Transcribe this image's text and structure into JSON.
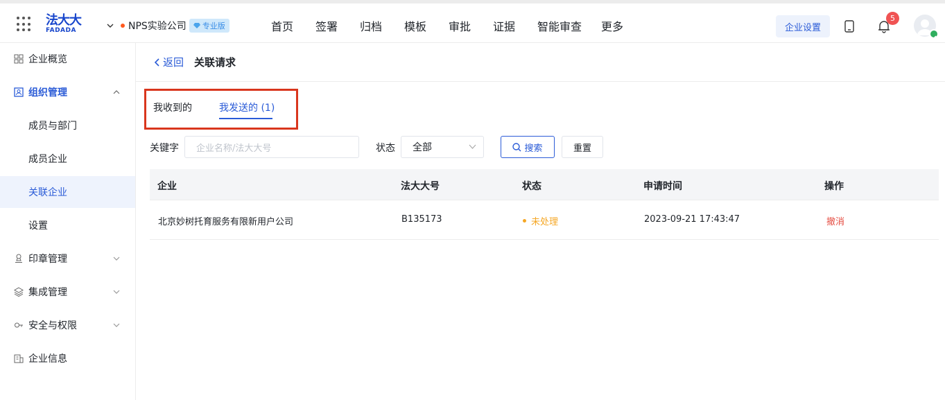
{
  "header": {
    "logo_line1": "法大大",
    "logo_line2": "FADADA",
    "company_name": "NPS实验公司",
    "edition_badge": "专业版",
    "nav": [
      "首页",
      "签署",
      "归档",
      "模板",
      "审批",
      "证据",
      "智能审查",
      "更多"
    ],
    "enterprise_settings": "企业设置",
    "notification_count": "5"
  },
  "sidebar": {
    "items": [
      {
        "label": "企业概览",
        "icon": "overview-icon"
      },
      {
        "label": "组织管理",
        "icon": "org-icon",
        "expanded": true
      },
      {
        "label": "成员与部门"
      },
      {
        "label": "成员企业"
      },
      {
        "label": "关联企业",
        "selected": true
      },
      {
        "label": "设置"
      },
      {
        "label": "印章管理",
        "icon": "seal-icon"
      },
      {
        "label": "集成管理",
        "icon": "layers-icon"
      },
      {
        "label": "安全与权限",
        "icon": "security-icon"
      },
      {
        "label": "企业信息",
        "icon": "building-icon"
      }
    ]
  },
  "page": {
    "back_label": "返回",
    "title": "关联请求",
    "tabs": [
      {
        "label": "我收到的"
      },
      {
        "label": "我发送的 (1)",
        "active": true
      }
    ],
    "filters": {
      "keyword_label": "关键字",
      "keyword_placeholder": "企业名称/法大大号",
      "status_label": "状态",
      "status_value": "全部",
      "search_label": "搜索",
      "reset_label": "重置"
    },
    "table": {
      "columns": [
        "企业",
        "法大大号",
        "状态",
        "申请时间",
        "操作"
      ],
      "rows": [
        {
          "company": "北京妙树托育服务有限新用户公司",
          "fdd_id": "B135173",
          "status": "未处理",
          "time": "2023-09-21 17:43:47",
          "action": "撤消"
        }
      ]
    }
  },
  "colors": {
    "accent": "#2a5bd7",
    "highlight_border": "#d9361d",
    "pending": "#f5a623",
    "danger": "#e54d42"
  }
}
